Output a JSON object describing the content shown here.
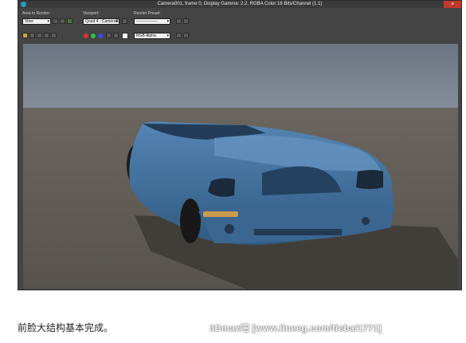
{
  "window": {
    "title": "Camera001, frame 0, Display Gamma: 2.2, RGBA Color 16 Bits/Channel (1:1)",
    "close_symbol": "×"
  },
  "toolbar": {
    "area_label": "Area to Render:",
    "area_value": "View",
    "viewport_label": "Viewport:",
    "viewport_value": "Quad 4 - Camera0",
    "preset_label": "Render Preset:",
    "preset_value": "----------------",
    "channel_value": "RGB Alpha"
  },
  "colors": {
    "red_channel": "#e03030",
    "green_channel": "#30c040",
    "blue_channel": "#3050e0",
    "car_body": "#3f6f9c",
    "sky": "#7d8896",
    "floor": "#5f5a54"
  },
  "caption": "前脸大结构基本完成。",
  "watermark": "3Dmax吧 [www.lineeg.com/tieba/1771]"
}
